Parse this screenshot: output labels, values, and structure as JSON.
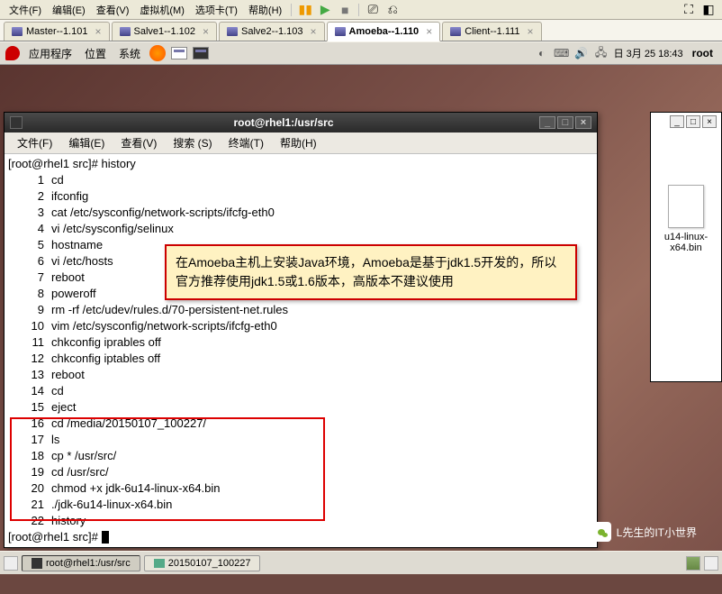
{
  "vm_menu": {
    "file": "文件(F)",
    "edit": "编辑(E)",
    "view": "查看(V)",
    "vm": "虚拟机(M)",
    "tabs": "选项卡(T)",
    "help": "帮助(H)"
  },
  "vm_tabs": [
    {
      "label": "Master--1.101"
    },
    {
      "label": "Salve1--1.102"
    },
    {
      "label": "Salve2--1.103"
    },
    {
      "label": "Amoeba--1.110"
    },
    {
      "label": "Client--1.111"
    }
  ],
  "gnome": {
    "apps": "应用程序",
    "places": "位置",
    "system": "系统",
    "clock": "日  3月 25  18:43",
    "user": "root"
  },
  "file_icon": {
    "name": "u14-linux-x64.bin"
  },
  "terminal": {
    "title": "root@rhel1:/usr/src",
    "menu": {
      "file": "文件(F)",
      "edit": "编辑(E)",
      "view": "查看(V)",
      "search": "搜索 (S)",
      "terminal": "终端(T)",
      "help": "帮助(H)"
    },
    "prompt1": "[root@rhel1 src]# history",
    "lines": [
      {
        "n": "1",
        "t": "cd"
      },
      {
        "n": "2",
        "t": "ifconfig"
      },
      {
        "n": "3",
        "t": "cat /etc/sysconfig/network-scripts/ifcfg-eth0"
      },
      {
        "n": "4",
        "t": "vi /etc/sysconfig/selinux"
      },
      {
        "n": "5",
        "t": "hostname"
      },
      {
        "n": "6",
        "t": "vi /etc/hosts"
      },
      {
        "n": "7",
        "t": "reboot"
      },
      {
        "n": "8",
        "t": "poweroff"
      },
      {
        "n": "9",
        "t": "rm -rf /etc/udev/rules.d/70-persistent-net.rules"
      },
      {
        "n": "10",
        "t": "vim /etc/sysconfig/network-scripts/ifcfg-eth0"
      },
      {
        "n": "11",
        "t": "chkconfig iprables off"
      },
      {
        "n": "12",
        "t": "chkconfig iptables off"
      },
      {
        "n": "13",
        "t": "reboot"
      },
      {
        "n": "14",
        "t": "cd"
      },
      {
        "n": "15",
        "t": "eject"
      },
      {
        "n": "16",
        "t": "cd /media/20150107_100227/"
      },
      {
        "n": "17",
        "t": "ls"
      },
      {
        "n": "18",
        "t": "cp * /usr/src/"
      },
      {
        "n": "19",
        "t": "cd /usr/src/"
      },
      {
        "n": "20",
        "t": "chmod +x jdk-6u14-linux-x64.bin"
      },
      {
        "n": "21",
        "t": "./jdk-6u14-linux-x64.bin"
      },
      {
        "n": "22",
        "t": "history"
      }
    ],
    "prompt2": "[root@rhel1 src]# "
  },
  "callout": "在Amoeba主机上安装Java环境，Amoeba是基于jdk1.5开发的，所以官方推荐使用jdk1.5或1.6版本，高版本不建议使用",
  "watermark": "L先生的IT小世界",
  "taskbar": {
    "item1": "root@rhel1:/usr/src",
    "item2": "20150107_100227"
  }
}
